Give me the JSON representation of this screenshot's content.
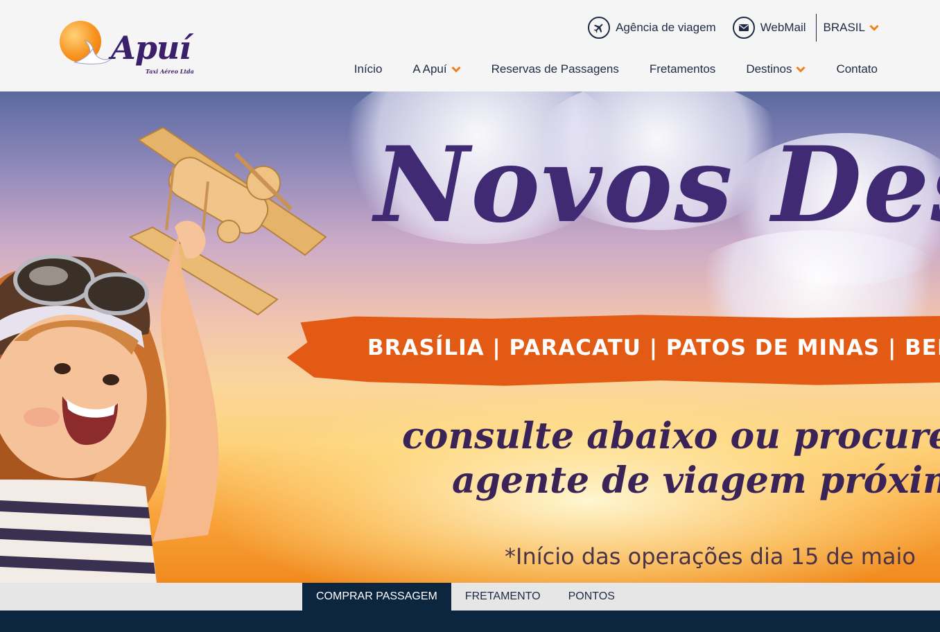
{
  "brand": {
    "name": "Apuí",
    "subtitle": "Taxi Aéreo Ltda"
  },
  "topbar": {
    "agency_label": "Agência de viagem",
    "webmail_label": "WebMail",
    "country_label": "BRASIL"
  },
  "nav": {
    "items": [
      {
        "label": "Início",
        "has_dropdown": false
      },
      {
        "label": "A Apuí",
        "has_dropdown": true
      },
      {
        "label": "Reservas de Passagens",
        "has_dropdown": false
      },
      {
        "label": "Fretamentos",
        "has_dropdown": false
      },
      {
        "label": "Destinos",
        "has_dropdown": true
      },
      {
        "label": "Contato",
        "has_dropdown": false
      }
    ]
  },
  "hero": {
    "title": "Novos Destinos",
    "destinations": "BRASÍLIA | PARACATU | PATOS DE MINAS | BELO HORIZONTE",
    "subtitle_line1": "consulte abaixo ou procure",
    "subtitle_line2": "agente de viagem próximo",
    "note": "*Início das operações dia 15 de maio"
  },
  "tabs": [
    {
      "label": "COMPRAR PASSAGEM",
      "active": true
    },
    {
      "label": "FRETAMENTO",
      "active": false
    },
    {
      "label": "PONTOS",
      "active": false
    }
  ],
  "colors": {
    "accent": "#f07e1a",
    "nav_text": "#1f2a44",
    "dark_band": "#0d2640",
    "brand_purple": "#3f2a73",
    "brush_orange": "#e25a14"
  },
  "icons": {
    "agency": "airplane-icon",
    "webmail": "envelope-icon",
    "dropdown": "chevron-down-icon"
  }
}
